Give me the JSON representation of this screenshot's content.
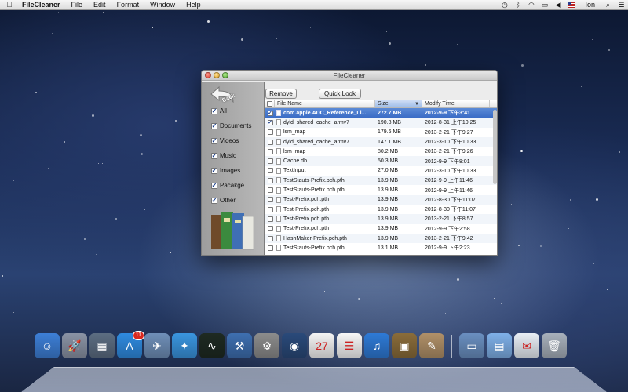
{
  "menubar": {
    "apple_icon": "apple-logo",
    "app_name": "FileCleaner",
    "menus": [
      "File",
      "Edit",
      "Format",
      "Window",
      "Help"
    ],
    "user": "Ion"
  },
  "window": {
    "title": "FileCleaner",
    "back_label": "Back",
    "toolbar": {
      "remove_label": "Remove",
      "quicklook_label": "Quick Look"
    },
    "categories": [
      {
        "label": "All",
        "checked": true
      },
      {
        "label": "Documents",
        "checked": true
      },
      {
        "label": "Videos",
        "checked": true
      },
      {
        "label": "Music",
        "checked": true
      },
      {
        "label": "Images",
        "checked": true
      },
      {
        "label": "Pacakge",
        "checked": true
      },
      {
        "label": "Other",
        "checked": true
      }
    ],
    "table": {
      "columns": [
        "File Name",
        "Size",
        "Modify Time"
      ],
      "rows": [
        {
          "name": "com.apple.ADC_Reference_Li...",
          "size": "272.7 MB",
          "time": "2012-9-9 下午3:41",
          "checked": true,
          "selected": true
        },
        {
          "name": "dyld_shared_cache_armv7",
          "size": "190.8 MB",
          "time": "2012-8-31 上午10:25",
          "checked": true,
          "selected": false
        },
        {
          "name": "lsm_map",
          "size": "179.6 MB",
          "time": "2013-2-21 下午9:27",
          "checked": false,
          "selected": false
        },
        {
          "name": "dyld_shared_cache_armv7",
          "size": "147.1 MB",
          "time": "2012-3-10 下午10:33",
          "checked": false,
          "selected": false
        },
        {
          "name": "lsm_map",
          "size": "80.2 MB",
          "time": "2013-2-21 下午9:26",
          "checked": false,
          "selected": false
        },
        {
          "name": "Cache.db",
          "size": "50.3 MB",
          "time": "2012-9-9 下午8:01",
          "checked": false,
          "selected": false
        },
        {
          "name": "TextInput",
          "size": "27.0 MB",
          "time": "2012-3-10 下午10:33",
          "checked": false,
          "selected": false
        },
        {
          "name": "TestStauts-Prefix.pch.pth",
          "size": "13.9 MB",
          "time": "2012-9-9 上午11:46",
          "checked": false,
          "selected": false
        },
        {
          "name": "TestStauts-Prefix.pch.pth",
          "size": "13.9 MB",
          "time": "2012-9-9 上午11:46",
          "checked": false,
          "selected": false
        },
        {
          "name": "Test-Prefix.pch.pth",
          "size": "13.9 MB",
          "time": "2012-8-30 下午11:07",
          "checked": false,
          "selected": false
        },
        {
          "name": "Test-Prefix.pch.pth",
          "size": "13.9 MB",
          "time": "2012-8-30 下午11:07",
          "checked": false,
          "selected": false
        },
        {
          "name": "Test-Prefix.pch.pth",
          "size": "13.9 MB",
          "time": "2013-2-21 下午8:57",
          "checked": false,
          "selected": false
        },
        {
          "name": "Test-Prefix.pch.pth",
          "size": "13.9 MB",
          "time": "2012-9-9 下午2:58",
          "checked": false,
          "selected": false
        },
        {
          "name": "HashMaker-Prefix.pch.pth",
          "size": "13.9 MB",
          "time": "2013-2-21 下午9:42",
          "checked": false,
          "selected": false
        },
        {
          "name": "TestStauts-Prefix.pch.pth",
          "size": "13.1 MB",
          "time": "2012-9-9 下午2:23",
          "checked": false,
          "selected": false
        }
      ]
    }
  },
  "dock": {
    "apps": [
      {
        "name": "finder",
        "color": "#3d7fd6",
        "glyph": "☺"
      },
      {
        "name": "launchpad",
        "color": "#8a93a5",
        "glyph": "🚀"
      },
      {
        "name": "photo-browser",
        "color": "#5c6d82",
        "glyph": "▦"
      },
      {
        "name": "app-store",
        "color": "#2f8be0",
        "glyph": "A",
        "badge": "11"
      },
      {
        "name": "preview",
        "color": "#6f8fb8",
        "glyph": "✈"
      },
      {
        "name": "safari",
        "color": "#3a95df",
        "glyph": "✦"
      },
      {
        "name": "activity-monitor",
        "color": "#1e2a22",
        "glyph": "∿"
      },
      {
        "name": "xcode",
        "color": "#3e6fb0",
        "glyph": "⚒"
      },
      {
        "name": "system-preferences",
        "color": "#8c8c8c",
        "glyph": "⚙"
      },
      {
        "name": "facetime",
        "color": "#2a4a7a",
        "glyph": "◉"
      },
      {
        "name": "calendar",
        "color": "#f4f4f4",
        "glyph": "27"
      },
      {
        "name": "reminders",
        "color": "#f7f7f7",
        "glyph": "☰"
      },
      {
        "name": "itunes",
        "color": "#2e7ad6",
        "glyph": "♫"
      },
      {
        "name": "iphoto",
        "color": "#8a6c3a",
        "glyph": "▣"
      },
      {
        "name": "books",
        "color": "#b09068",
        "glyph": "✎"
      }
    ],
    "stack_items": [
      {
        "name": "screen-capture",
        "color": "#6a8fc0",
        "glyph": "▭"
      },
      {
        "name": "folder",
        "color": "#7fb0e8",
        "glyph": "▤"
      },
      {
        "name": "mail-document",
        "color": "#e8eef5",
        "glyph": "✉"
      },
      {
        "name": "trash",
        "color": "#a7b0bb",
        "glyph": "🗑"
      }
    ]
  }
}
